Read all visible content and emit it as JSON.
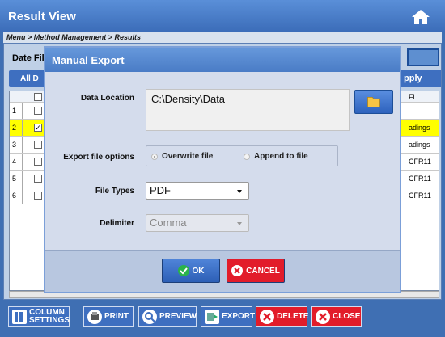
{
  "window": {
    "title": "Result View",
    "home_icon": "home-icon"
  },
  "breadcrumb": "Menu > Method Management > Results",
  "filter": {
    "date_label": "Date Fil",
    "all_button": "All D",
    "apply_button": "pply"
  },
  "grid": {
    "rows": [
      {
        "num": "1",
        "checked": false,
        "file": "",
        "highlight": false
      },
      {
        "num": "2",
        "checked": true,
        "file": "adings",
        "highlight": true
      },
      {
        "num": "3",
        "checked": false,
        "file": "adings",
        "highlight": false
      },
      {
        "num": "4",
        "checked": false,
        "file": "CFR11",
        "highlight": false
      },
      {
        "num": "5",
        "checked": false,
        "file": "CFR11",
        "highlight": false
      },
      {
        "num": "6",
        "checked": false,
        "file": "CFR11",
        "highlight": false
      }
    ],
    "header_file": "Fi"
  },
  "toolbar": {
    "column_settings": "COLUMN SETTINGS",
    "print": "PRINT",
    "preview": "PREVIEW",
    "export": "EXPORT",
    "delete": "DELETE",
    "close": "CLOSE"
  },
  "dialog": {
    "title": "Manual Export",
    "data_location_label": "Data Location",
    "data_location_value": "C:\\Density\\Data",
    "export_options_label": "Export file options",
    "overwrite_label": "Overwrite file",
    "append_label": "Append to file",
    "file_types_label": "File Types",
    "file_types_value": "PDF",
    "delimiter_label": "Delimiter",
    "delimiter_value": "Comma",
    "ok_label": "OK",
    "cancel_label": "CANCEL"
  },
  "colors": {
    "accent": "#3e6fc0",
    "danger": "#e21c2a",
    "highlight": "#ffff00"
  }
}
